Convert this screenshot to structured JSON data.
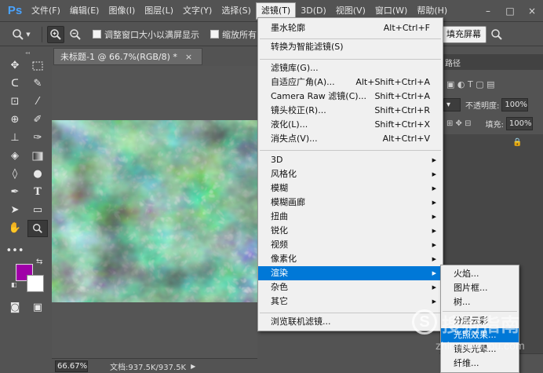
{
  "app": {
    "logo": "Ps"
  },
  "menubar": [
    {
      "label": "文件(F)"
    },
    {
      "label": "编辑(E)"
    },
    {
      "label": "图像(I)"
    },
    {
      "label": "图层(L)"
    },
    {
      "label": "文字(Y)"
    },
    {
      "label": "选择(S)"
    },
    {
      "label": "滤镜(T)",
      "active": true
    },
    {
      "label": "3D(D)"
    },
    {
      "label": "视图(V)"
    },
    {
      "label": "窗口(W)"
    },
    {
      "label": "帮助(H)"
    }
  ],
  "window_controls": {
    "minimize": "–",
    "maximize": "□",
    "close": "×"
  },
  "options_bar": {
    "zoom_icon": "🔍",
    "zoom_in": "+",
    "zoom_out": "−",
    "resize_windows_label": "调整窗口大小以满屏显示",
    "zoom_all_label": "缩放所有",
    "fill_screen_label": "填充屏幕"
  },
  "document": {
    "tab_title": "未标题-1 @ 66.7%(RGB/8) *",
    "tab_close": "×",
    "zoom": "66.67%",
    "doc_size": "文档:937.5K/937.5K"
  },
  "colors": {
    "foreground": "#a000a8",
    "background": "#ffffff",
    "menu_highlight": "#0078d7"
  },
  "right_panel": {
    "opacity_label": "不透明度:",
    "opacity_value": "100%",
    "fill_label": "填充:",
    "fill_value": "100%",
    "tab_label": "路径",
    "lock_icon": "🔒"
  },
  "filter_menu": {
    "items": [
      {
        "label": "墨水轮廓",
        "shortcut": "Alt+Ctrl+F"
      },
      {
        "label": "转换为智能滤镜(S)",
        "shortcut": ""
      },
      {
        "label": "滤镜库(G)...",
        "shortcut": ""
      },
      {
        "label": "自适应广角(A)...",
        "shortcut": "Alt+Shift+Ctrl+A"
      },
      {
        "label": "Camera Raw 滤镜(C)...",
        "shortcut": "Shift+Ctrl+A"
      },
      {
        "label": "镜头校正(R)...",
        "shortcut": "Shift+Ctrl+R"
      },
      {
        "label": "液化(L)...",
        "shortcut": "Shift+Ctrl+X"
      },
      {
        "label": "消失点(V)...",
        "shortcut": "Alt+Ctrl+V"
      },
      {
        "label": "3D",
        "submenu": true
      },
      {
        "label": "风格化",
        "submenu": true
      },
      {
        "label": "模糊",
        "submenu": true
      },
      {
        "label": "模糊画廊",
        "submenu": true
      },
      {
        "label": "扭曲",
        "submenu": true
      },
      {
        "label": "锐化",
        "submenu": true
      },
      {
        "label": "视频",
        "submenu": true
      },
      {
        "label": "像素化",
        "submenu": true
      },
      {
        "label": "渲染",
        "submenu": true,
        "highlighted": true
      },
      {
        "label": "杂色",
        "submenu": true
      },
      {
        "label": "其它",
        "submenu": true
      },
      {
        "label": "浏览联机滤镜...",
        "shortcut": ""
      }
    ]
  },
  "render_submenu": {
    "items": [
      {
        "label": "火焰..."
      },
      {
        "label": "图片框..."
      },
      {
        "label": "树..."
      },
      {
        "label": "分层云彩"
      },
      {
        "label": "光照效果...",
        "highlighted": true
      },
      {
        "label": "镜头光晕..."
      },
      {
        "label": "纤维..."
      }
    ]
  },
  "watermark": {
    "logo": "S",
    "text": "搜狗指南",
    "url": "zhinan.sogou.com"
  }
}
